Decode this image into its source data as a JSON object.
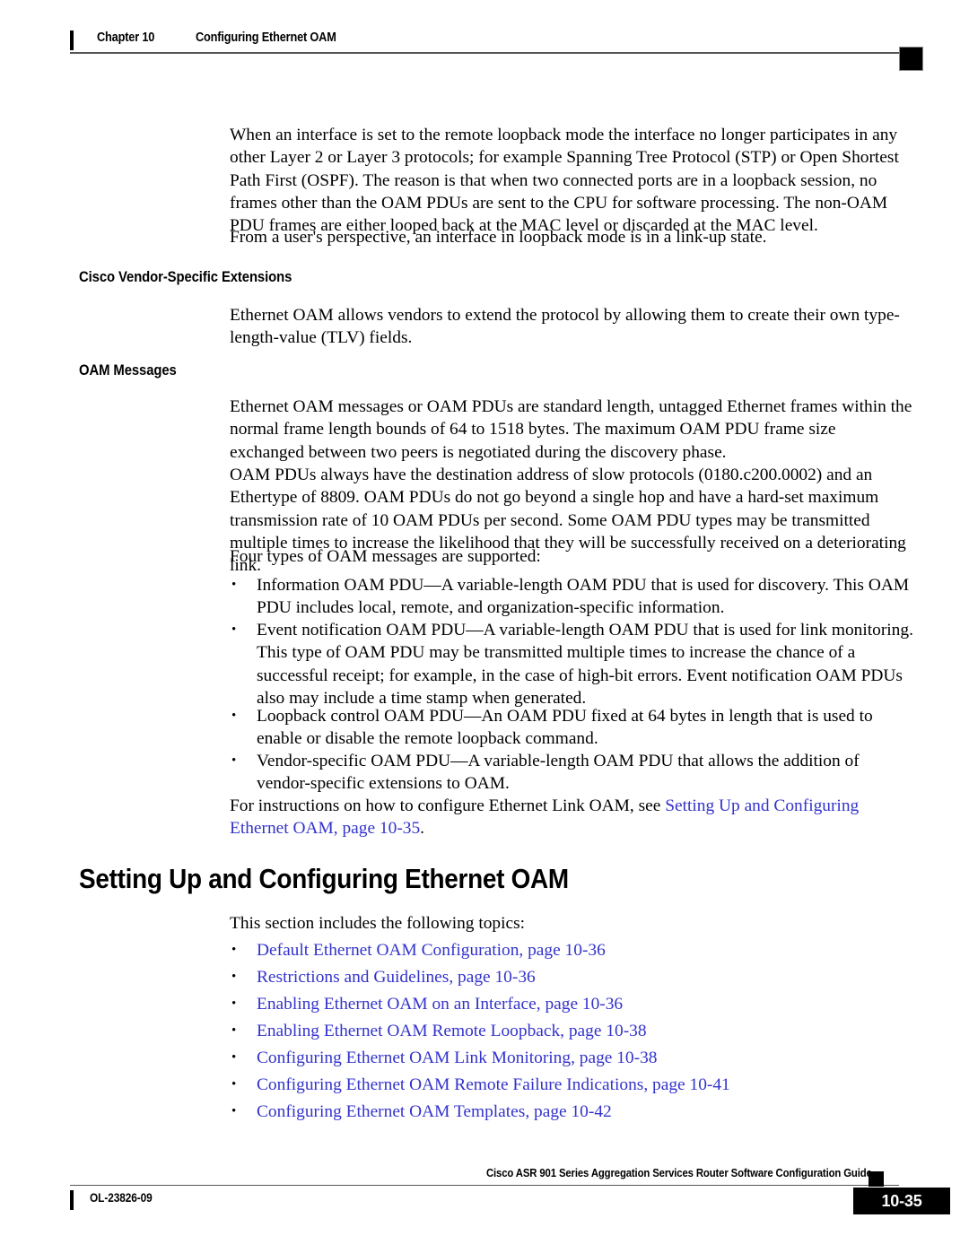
{
  "header": {
    "chapter": "Chapter 10",
    "title": "Configuring Ethernet OAM"
  },
  "body": {
    "paragraph_1": "When an interface is set to the remote loopback mode the interface no longer participates in any other Layer 2 or Layer 3 protocols; for example Spanning Tree Protocol (STP) or Open Shortest Path First (OSPF). The reason is that when two connected ports are in a loopback session, no frames other than the OAM PDUs are sent to the CPU for software processing. The non-OAM PDU frames are either looped back at the MAC level or discarded at the MAC level.",
    "paragraph_2": "From a user's perspective, an interface in loopback mode is in a link-up state.",
    "heading_vendor_extensions": "Cisco Vendor-Specific Extensions",
    "paragraph_3": "Ethernet OAM allows vendors to extend the protocol by allowing them to create their own type-length-value (TLV) fields.",
    "heading_oam_messages": "OAM Messages",
    "paragraph_4": "Ethernet OAM messages or OAM PDUs are standard length, untagged Ethernet frames within the normal frame length bounds of 64 to 1518 bytes. The maximum OAM PDU frame size exchanged between two peers is negotiated during the discovery phase.",
    "paragraph_5": "OAM PDUs always have the destination address of slow protocols (0180.c200.0002) and an Ethertype of 8809. OAM PDUs do not go beyond a single hop and have a hard-set maximum transmission rate of 10 OAM PDUs per second. Some OAM PDU types may be transmitted multiple times to increase the likelihood that they will be successfully received on a deteriorating link.",
    "paragraph_6": "Four types of OAM messages are supported:",
    "oam_message_bullets": [
      "Information OAM PDU—A variable-length OAM PDU that is used for discovery. This OAM PDU includes local, remote, and organization-specific information.",
      "Event notification OAM PDU—A variable-length OAM PDU that is used for link monitoring. This type of OAM PDU may be transmitted multiple times to increase the chance of a successful receipt; for example, in the case of high-bit errors. Event notification OAM PDUs also may include a time stamp when generated.",
      "Loopback control OAM PDU—An OAM PDU fixed at 64 bytes in length that is used to enable or disable the remote loopback command.",
      "Vendor-specific OAM PDU—A variable-length OAM PDU that allows the addition of vendor-specific extensions to OAM."
    ],
    "cross_reference": {
      "lead_text": "For instructions on how to configure Ethernet Link OAM, see ",
      "link_text": "Setting Up and Configuring Ethernet OAM, page 10-35",
      "trailing_text": "."
    },
    "bullet_glyph": "•"
  },
  "section": {
    "heading": "Setting Up and Configuring Ethernet OAM",
    "intro": "This section includes the following topics:",
    "topics": [
      "Default Ethernet OAM Configuration, page 10-36",
      "Restrictions and Guidelines, page 10-36",
      "Enabling Ethernet OAM on an Interface, page 10-36",
      "Enabling Ethernet OAM Remote Loopback, page 10-38",
      "Configuring Ethernet OAM Link Monitoring, page 10-38",
      "Configuring Ethernet OAM Remote Failure Indications, page 10-41",
      "Configuring Ethernet OAM Templates, page 10-42"
    ]
  },
  "footer": {
    "doc_id": "OL-23826-09",
    "guide_title": "Cisco ASR 901 Series Aggregation Services Router Software Configuration Guide",
    "page_number": "10-35"
  },
  "colors": {
    "link": "#3333cc",
    "text": "#000000",
    "rule": "#555555"
  }
}
